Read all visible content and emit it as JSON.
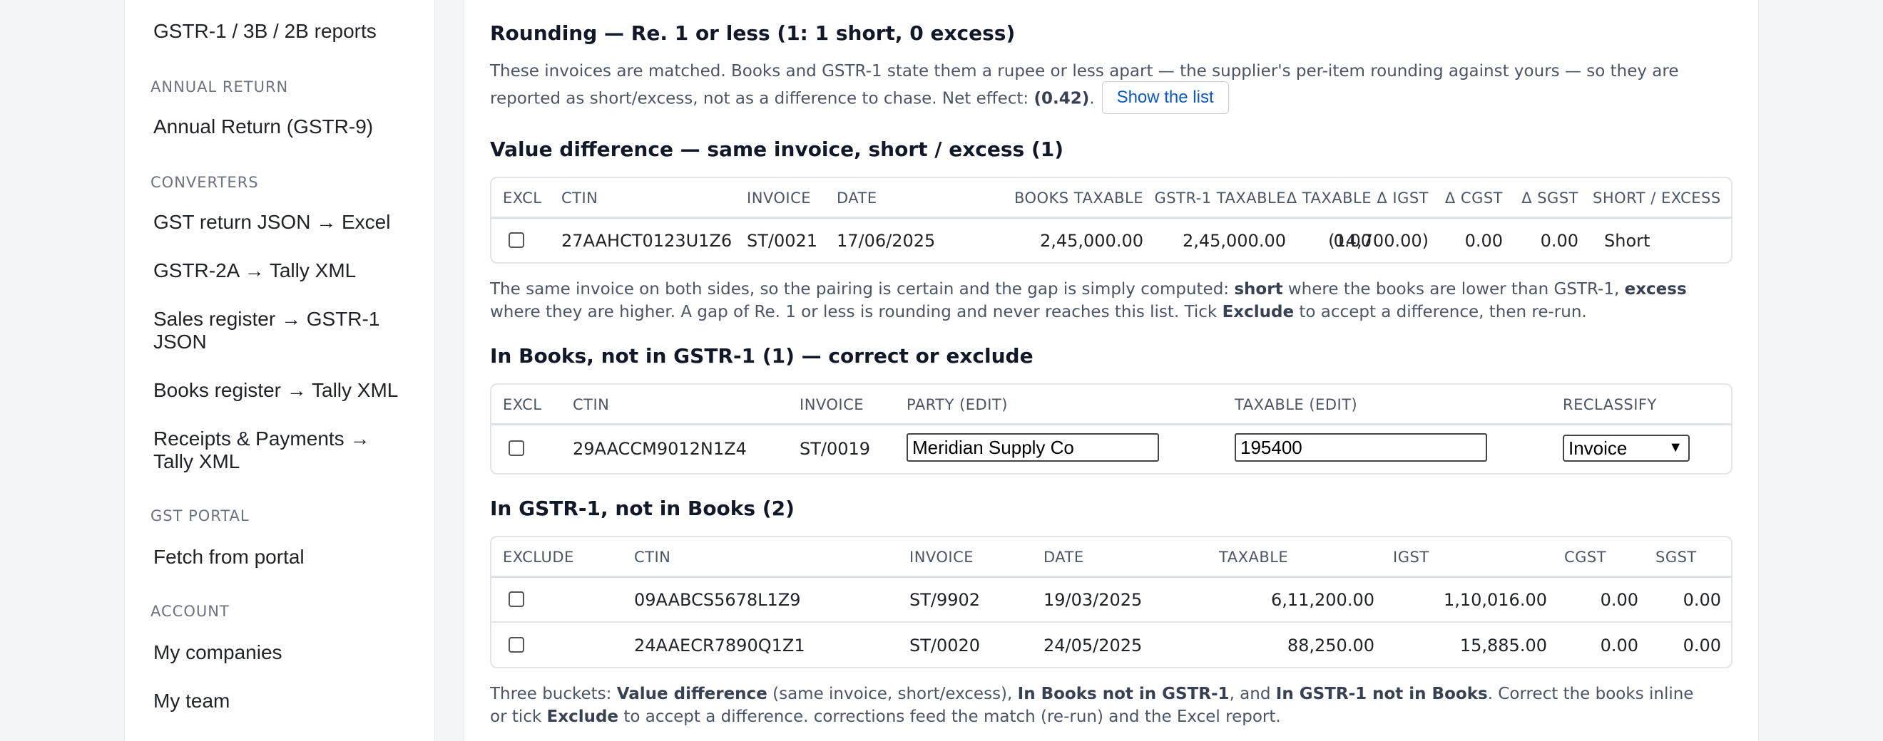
{
  "sidebar": {
    "items": {
      "gstr_reports": "GSTR-1 / 3B / 2B reports",
      "annual_return": "Annual Return (GSTR-9)",
      "json_excel": "GST return JSON → Excel",
      "gstr2a_tally": "GSTR-2A → Tally XML",
      "sales_register": "Sales register → GSTR-1 JSON",
      "books_register": "Books register → Tally XML",
      "receipts_payments": "Receipts & Payments → Tally XML",
      "fetch_portal": "Fetch from portal",
      "my_companies": "My companies",
      "my_team": "My team"
    },
    "sections": {
      "annual_return": "ANNUAL RETURN",
      "converters": "CONVERTERS",
      "gst_portal": "GST PORTAL",
      "account": "ACCOUNT"
    }
  },
  "rounding": {
    "title": "Rounding — Re. 1 or less (1: 1 short, 0 excess)",
    "desc": "These invoices are matched. Books and GSTR-1 state them a rupee or less apart — the supplier's per-item rounding against yours — so they are reported as short/excess, not as a difference to chase. Net effect: ",
    "net_effect": "(0.42)",
    "period": ".",
    "show_list_label": "Show the list"
  },
  "value_diff": {
    "title": "Value difference — same invoice, short / excess (1)",
    "headers": {
      "excl": "EXCL",
      "ctin": "CTIN",
      "invoice": "INVOICE",
      "date": "DATE",
      "books_taxable": "BOOKS TAXABLE",
      "gstr1_taxable": "GSTR-1 TAXABLE",
      "d_taxable": "Δ TAXABLE",
      "d_igst": "Δ IGST",
      "d_cgst": "Δ CGST",
      "d_sgst": "Δ SGST",
      "short_excess": "SHORT / EXCESS"
    },
    "rows": [
      {
        "ctin": "27AAHCT0123U1Z6",
        "invoice": "ST/0021",
        "date": "17/06/2025",
        "books_taxable": "2,45,000.00",
        "gstr1_taxable": "2,45,000.00",
        "d_taxable": "0.00",
        "d_igst": "(14,700.00)",
        "d_cgst": "0.00",
        "d_sgst": "0.00",
        "short_excess": "Short"
      }
    ],
    "note": {
      "p1": "The same invoice on both sides, so the pairing is certain and the gap is simply computed: ",
      "b1": "short",
      "p2": " where the books are lower than GSTR-1, ",
      "b2": "excess",
      "p3": " where they are higher. A gap of Re. 1 or less is rounding and never reaches this list. Tick ",
      "b3": "Exclude",
      "p4": " to accept a difference, then re-run."
    }
  },
  "in_books": {
    "title": "In Books, not in GSTR-1 (1) — correct or exclude",
    "headers": {
      "excl": "EXCL",
      "ctin": "CTIN",
      "invoice": "INVOICE",
      "party": "PARTY (EDIT)",
      "taxable": "TAXABLE (EDIT)",
      "reclassify": "RECLASSIFY"
    },
    "rows": [
      {
        "ctin": "29AACCM9012N1Z4",
        "invoice": "ST/0019",
        "party": "Meridian Supply Co",
        "taxable": "195400",
        "reclassify": "Invoice"
      }
    ]
  },
  "in_gstr1": {
    "title": "In GSTR-1, not in Books (2)",
    "headers": {
      "exclude": "EXCLUDE",
      "ctin": "CTIN",
      "invoice": "INVOICE",
      "date": "DATE",
      "taxable": "TAXABLE",
      "igst": "IGST",
      "cgst": "CGST",
      "sgst": "SGST"
    },
    "rows": [
      {
        "ctin": "09AABCS5678L1Z9",
        "invoice": "ST/9902",
        "date": "19/03/2025",
        "taxable": "6,11,200.00",
        "igst": "1,10,016.00",
        "cgst": "0.00",
        "sgst": "0.00"
      },
      {
        "ctin": "24AAECR7890Q1Z1",
        "invoice": "ST/0020",
        "date": "24/05/2025",
        "taxable": "88,250.00",
        "igst": "15,885.00",
        "cgst": "0.00",
        "sgst": "0.00"
      }
    ]
  },
  "footer_note": {
    "p1": "Three buckets: ",
    "b1": "Value difference",
    "p2": " (same invoice, short/excess), ",
    "b2": "In Books not in GSTR-1",
    "p3": ", and ",
    "b3": "In GSTR-1 not in Books",
    "p4": ". Correct the books inline or tick ",
    "b4": "Exclude",
    "p5": " to accept a difference. corrections feed the match (re-run) and the Excel report."
  }
}
